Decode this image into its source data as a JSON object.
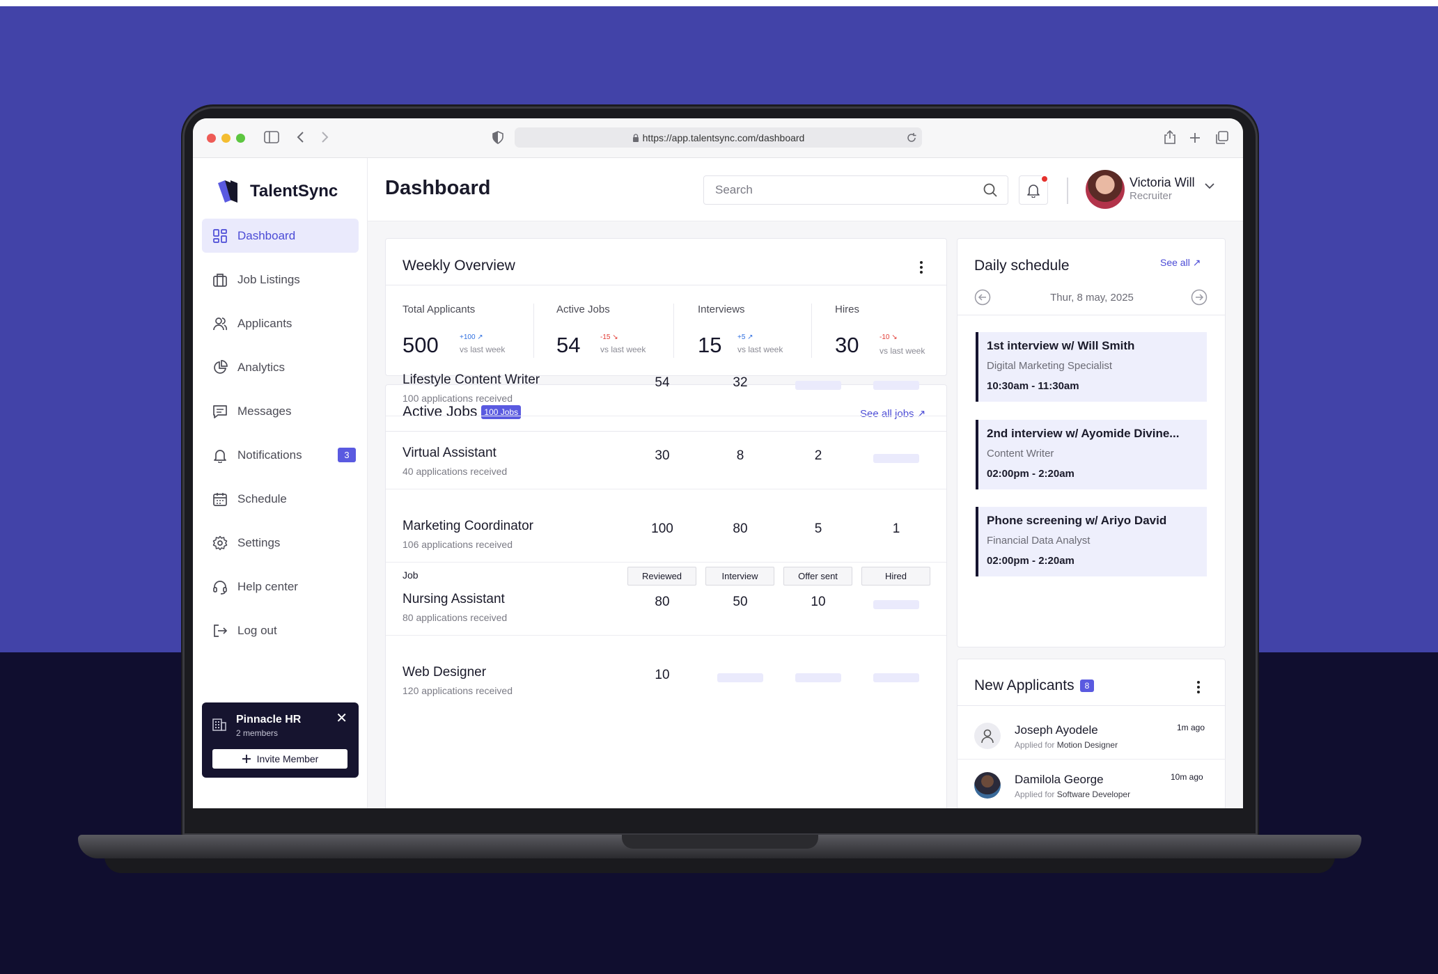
{
  "browser": {
    "url": "https://app.talentsync.com/dashboard"
  },
  "brand": {
    "name": "TalentSync",
    "accent": "#5a5ae0",
    "dark": "#16142f"
  },
  "sidebar": {
    "items": [
      {
        "label": "Dashboard",
        "icon": "grid-icon"
      },
      {
        "label": "Job Listings",
        "icon": "briefcase-icon"
      },
      {
        "label": "Applicants",
        "icon": "users-icon"
      },
      {
        "label": "Analytics",
        "icon": "pie-chart-icon"
      },
      {
        "label": "Messages",
        "icon": "message-icon"
      },
      {
        "label": "Notifications",
        "icon": "bell-icon",
        "badge": "3"
      },
      {
        "label": "Schedule",
        "icon": "calendar-icon"
      },
      {
        "label": "Settings",
        "icon": "gear-icon"
      },
      {
        "label": "Help center",
        "icon": "headset-icon"
      },
      {
        "label": "Log out",
        "icon": "logout-icon"
      }
    ],
    "org": {
      "name": "Pinnacle HR",
      "members": "2 members",
      "invite_label": "Invite Member"
    }
  },
  "header": {
    "title": "Dashboard",
    "search_placeholder": "Search",
    "user": {
      "name": "Victoria Will",
      "role": "Recruiter"
    }
  },
  "weekly": {
    "title": "Weekly Overview",
    "stats": [
      {
        "label": "Total Applicants",
        "value": "500",
        "delta": "+100",
        "direction": "up",
        "vs": "vs last week"
      },
      {
        "label": "Active Jobs",
        "value": "54",
        "delta": "-15",
        "direction": "down",
        "vs": "vs last week"
      },
      {
        "label": "Interviews",
        "value": "15",
        "delta": "+5",
        "direction": "up",
        "vs": "vs last week"
      },
      {
        "label": "Hires",
        "value": "30",
        "delta": "-10",
        "direction": "down",
        "vs": "vs last week"
      }
    ]
  },
  "active_jobs": {
    "title": "Active Jobs",
    "badge": "100 Jobs",
    "see_all": "See all jobs",
    "columns": {
      "job": "Job",
      "reviewed": "Reviewed",
      "interview": "Interview",
      "offer": "Offer sent",
      "hired": "Hired"
    },
    "rows": [
      {
        "title": "Lifestyle Content Writer",
        "sub": "100 applications received",
        "reviewed": "54",
        "interview": "32",
        "offer": null,
        "hired": null
      },
      {
        "title": "Virtual Assistant",
        "sub": "40 applications received",
        "reviewed": "30",
        "interview": "8",
        "offer": "2",
        "hired": null
      },
      {
        "title": "Marketing Coordinator",
        "sub": "106 applications received",
        "reviewed": "100",
        "interview": "80",
        "offer": "5",
        "hired": "1"
      },
      {
        "title": "Nursing Assistant",
        "sub": "80 applications received",
        "reviewed": "80",
        "interview": "50",
        "offer": "10",
        "hired": null
      },
      {
        "title": "Web Designer",
        "sub": "120 applications received",
        "reviewed": "10",
        "interview": null,
        "offer": null,
        "hired": null
      }
    ]
  },
  "schedule": {
    "title": "Daily schedule",
    "see_all": "See all",
    "date": "Thur, 8 may, 2025",
    "items": [
      {
        "title": "1st interview w/ Will Smith",
        "role": "Digital Marketing Specialist",
        "time": "10:30am - 11:30am"
      },
      {
        "title": "2nd interview w/ Ayomide Divine...",
        "role": "Content Writer",
        "time": "02:00pm - 2:20am"
      },
      {
        "title": "Phone screening w/ Ariyo David",
        "role": "Financial Data Analyst",
        "time": "02:00pm - 2:20am"
      }
    ]
  },
  "applicants": {
    "title": "New Applicants",
    "badge": "8",
    "applied_for": "Applied for",
    "items": [
      {
        "name": "Joseph Ayodele",
        "role": "Motion Designer",
        "time": "1m ago"
      },
      {
        "name": "Damilola George",
        "role": "Software Developer",
        "time": "10m ago"
      }
    ]
  }
}
